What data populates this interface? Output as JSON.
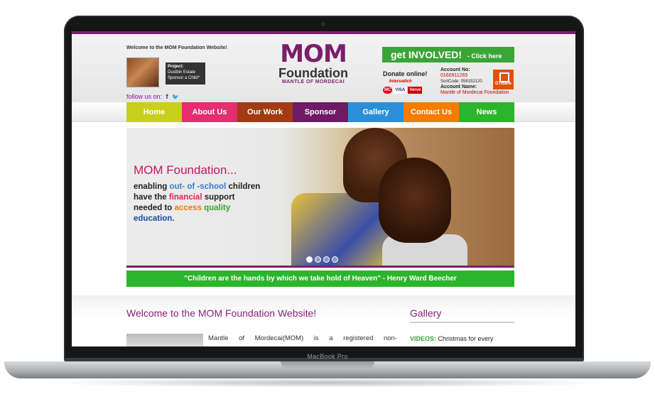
{
  "device": {
    "model_label": "MacBook Pro"
  },
  "header": {
    "welcome_small": "Welcome to the MOM Foundation Website!",
    "project_label": "Project:",
    "project_name": "Dustbin Estate",
    "project_sub": "Sponsor a Child*",
    "follow_label": "follow us on:",
    "social_facebook": "f",
    "social_twitter": "🐦",
    "logo_mom": "MOM",
    "logo_foundation": "Foundation",
    "logo_tagline": "MANTLE OF MORDECAI",
    "involved_main": "get INVOLVED!",
    "involved_sub": "- Click here",
    "donate_label": "Donate online!",
    "interswitch_label": "Interswitch",
    "card_labels": [
      "MC",
      "VISA",
      "Verve"
    ],
    "account_no_label": "Account No:",
    "account_no": "0160911265",
    "sort_code": "SortCode: 058152120",
    "account_name_label": "Account Name:",
    "account_name": "Mantle of Mordecai Foundation",
    "bank_label": "GTBank"
  },
  "nav": {
    "items": [
      {
        "label": "Home",
        "color": "#c9cf1a"
      },
      {
        "label": "About Us",
        "color": "#e62e6e"
      },
      {
        "label": "Our Work",
        "color": "#a33b12"
      },
      {
        "label": "Sponsor",
        "color": "#6f1a64"
      },
      {
        "label": "Gallery",
        "color": "#2b8fd8"
      },
      {
        "label": "Contact Us",
        "color": "#f57c00"
      },
      {
        "label": "News",
        "color": "#2bb52b"
      }
    ]
  },
  "hero": {
    "title": "MOM Foundation...",
    "line1_a": "enabling ",
    "line1_b": "out- of -school",
    "line1_c": " children",
    "line2_a": "have the ",
    "line2_b": "financial",
    "line2_c": " support",
    "line3_a": "needed to ",
    "line3_b": "access",
    "line3_c": " quality",
    "line4": "education."
  },
  "quote": "\"Children are the hands by which we take hold of Heaven\" - Henry Ward Beecher",
  "main": {
    "welcome_heading": "Welcome to the MOM Foundation Website!",
    "intro_text": "Mantle of Mordecai(MOM) is a registered non-",
    "gallery_heading": "Gallery",
    "videos_label": "VIDEOS:",
    "videos_text": "Christmas for every"
  }
}
